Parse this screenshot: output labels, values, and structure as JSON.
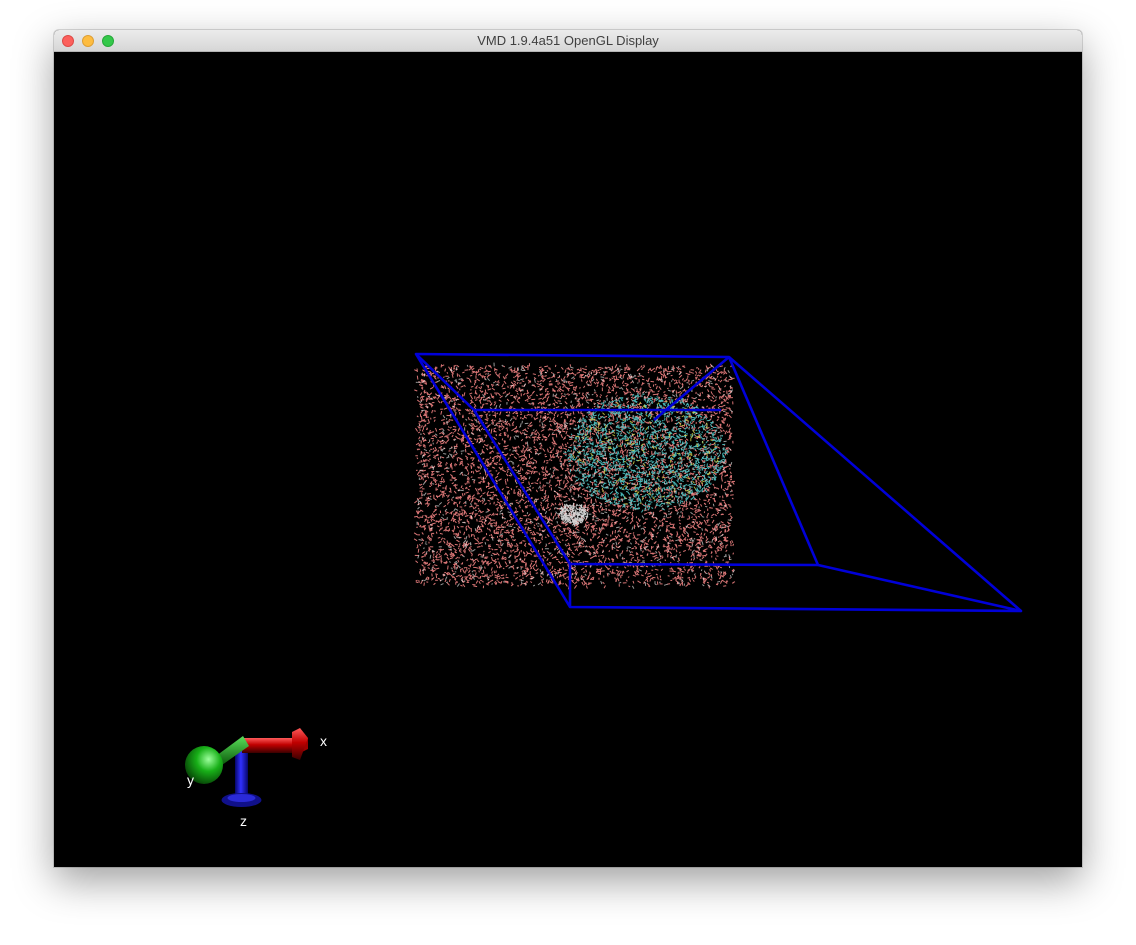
{
  "window": {
    "title": "VMD 1.9.4a51 OpenGL Display"
  },
  "axes": {
    "x_label": "x",
    "y_label": "y",
    "z_label": "z"
  },
  "colors": {
    "background": "#000000",
    "periodic_box": "#0000d8",
    "water": "#ff8a8a",
    "protein": "#4fc6c6",
    "x_axis": "#c00000",
    "y_axis": "#10a010",
    "z_axis": "#1010b0"
  },
  "icons": [
    "close-button",
    "minimize-button",
    "zoom-button"
  ]
}
